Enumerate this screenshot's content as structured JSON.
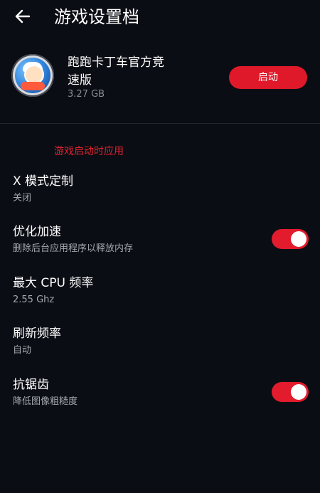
{
  "header": {
    "title": "游戏设置档",
    "back_icon": "back-arrow-icon"
  },
  "app": {
    "name": "跑跑卡丁车官方竞速版",
    "size": "3.27 GB",
    "icon": "game-icon",
    "launch_label": "启动"
  },
  "section": {
    "label": "游戏启动时应用"
  },
  "settings": [
    {
      "title": "X 模式定制",
      "subtitle": "关闭"
    },
    {
      "title": "优化加速",
      "subtitle": "删除后台应用程序以释放内存",
      "toggle": true
    },
    {
      "title": "最大 CPU 频率",
      "subtitle": "2.55 Ghz"
    },
    {
      "title": "刷新频率",
      "subtitle": "自动"
    },
    {
      "title": "抗锯齿",
      "subtitle": "降低图像粗糙度",
      "toggle": true
    }
  ],
  "colors": {
    "background": "#0b0d14",
    "accent": "#e0192a",
    "section_label": "#e0232f",
    "subtitle": "#a5a8af"
  }
}
